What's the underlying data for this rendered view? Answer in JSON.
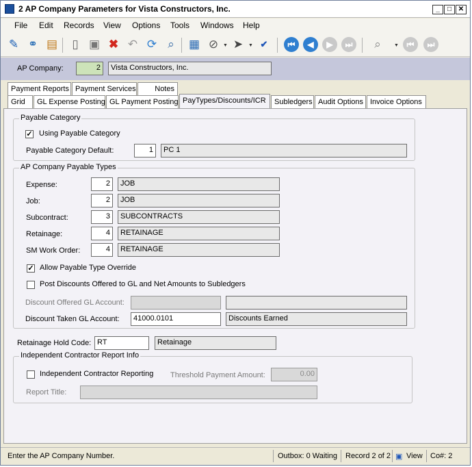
{
  "window": {
    "title": "2 AP Company Parameters for Vista Constructors, Inc."
  },
  "menu": [
    "File",
    "Edit",
    "Records",
    "View",
    "Options",
    "Tools",
    "Windows",
    "Help"
  ],
  "key": {
    "label": "AP Company:",
    "company_number": "2",
    "company_name": "Vista Constructors, Inc."
  },
  "tabs": {
    "row1": [
      "Payment Reports",
      "Payment Services",
      "Notes"
    ],
    "row2": [
      "Grid",
      "GL Expense Posting",
      "GL Payment Posting",
      "PayTypes/Discounts/ICR",
      "Subledgers",
      "Audit Options",
      "Invoice Options"
    ],
    "active": "PayTypes/Discounts/ICR"
  },
  "payable_category": {
    "title": "Payable Category",
    "using_label": "Using Payable Category",
    "using_checked": true,
    "default_label": "Payable Category Default:",
    "default_value": "1",
    "default_desc": "PC 1"
  },
  "payable_types": {
    "title": "AP Company Payable Types",
    "rows": [
      {
        "label": "Expense:",
        "value": "2",
        "desc": "JOB"
      },
      {
        "label": "Job:",
        "value": "2",
        "desc": "JOB"
      },
      {
        "label": "Subcontract:",
        "value": "3",
        "desc": "SUBCONTRACTS"
      },
      {
        "label": "Retainage:",
        "value": "4",
        "desc": "RETAINAGE"
      },
      {
        "label": "SM Work Order:",
        "value": "4",
        "desc": "RETAINAGE"
      }
    ],
    "allow_override_label": "Allow Payable Type Override",
    "allow_override_checked": true,
    "post_discounts_label": "Post Discounts Offered to GL and Net Amounts to Subledgers",
    "post_discounts_checked": false,
    "discount_offered_label": "Discount Offered GL Account:",
    "discount_offered_value": "",
    "discount_offered_desc": "",
    "discount_taken_label": "Discount Taken GL Account:",
    "discount_taken_value": "41000.0101",
    "discount_taken_desc": "Discounts Earned"
  },
  "retainage": {
    "label": "Retainage Hold Code:",
    "code": "RT",
    "desc": "Retainage"
  },
  "icr": {
    "title": "Independent Contractor Report Info",
    "reporting_label": "Independent Contractor Reporting",
    "reporting_checked": false,
    "threshold_label": "Threshold Payment Amount:",
    "threshold_value": "0.00",
    "report_title_label": "Report Title:",
    "report_title_value": ""
  },
  "status": {
    "message": "Enter the AP Company Number.",
    "outbox": "Outbox: 0 Waiting",
    "record": "Record 2 of 2",
    "view": "View",
    "company": "Co#: 2"
  },
  "colors": {
    "key_bar": "#c5c7db",
    "panel": "#f3f2f7",
    "nav_blue": "#2f7fd0"
  }
}
